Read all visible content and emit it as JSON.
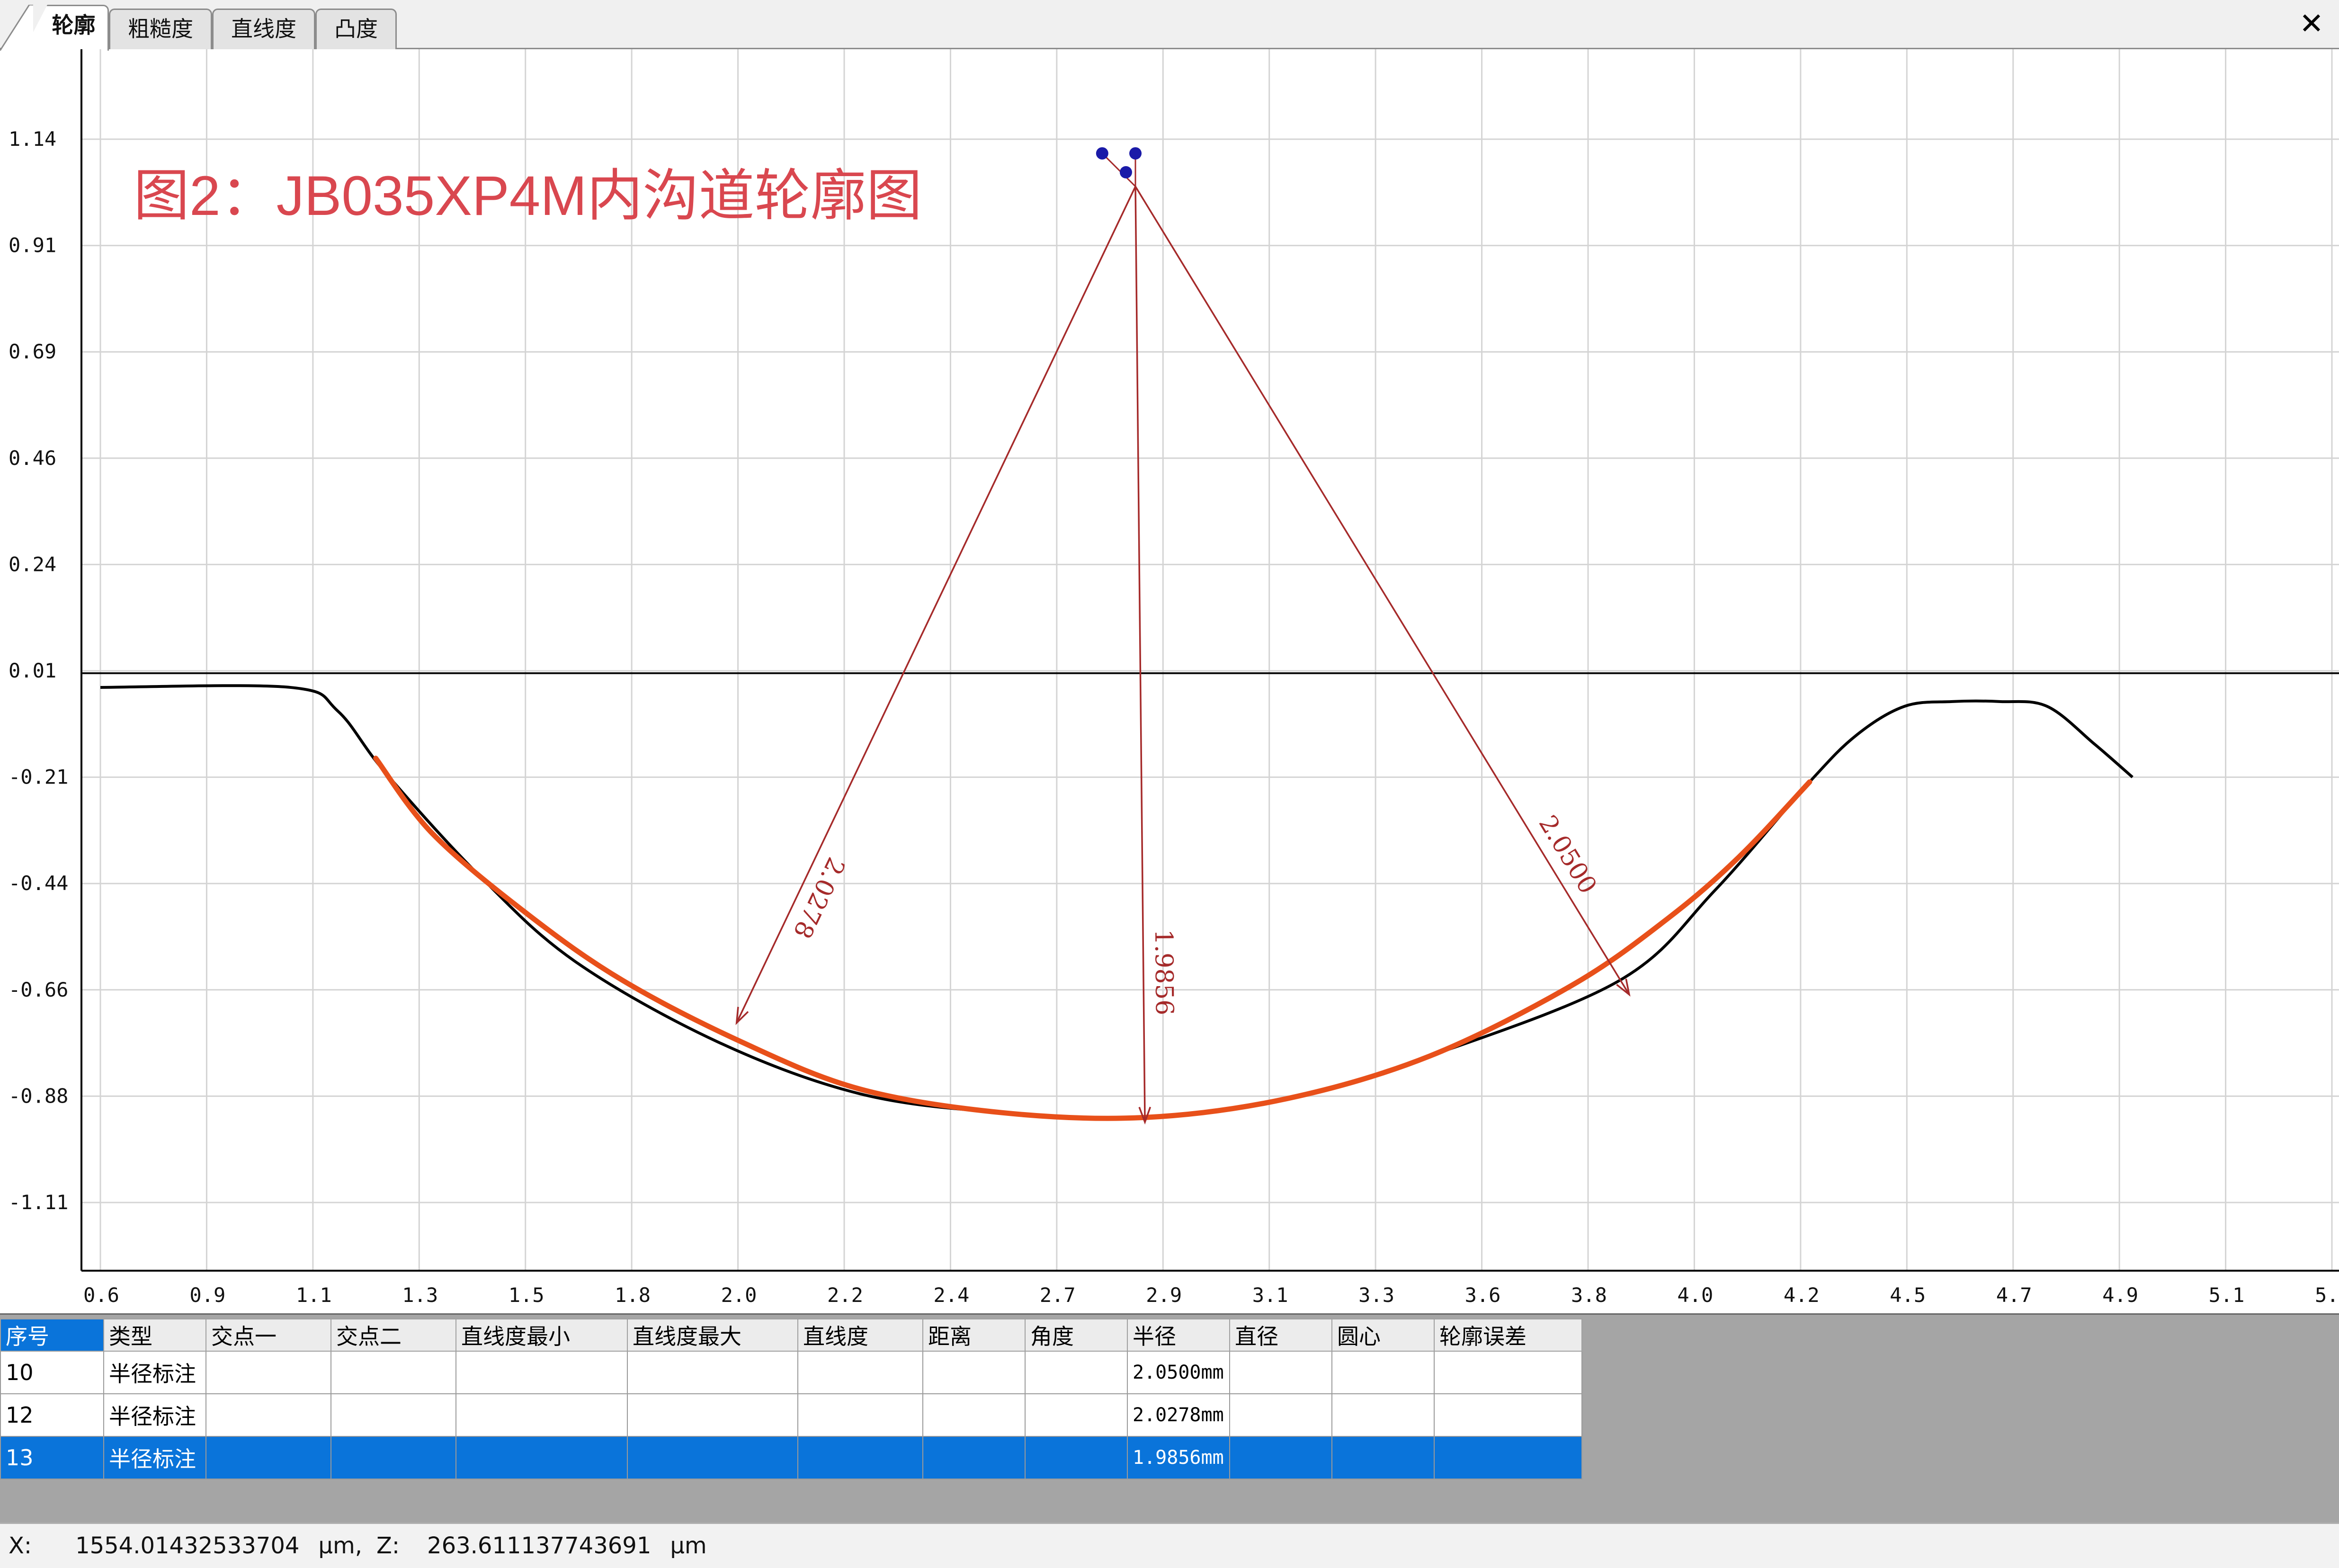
{
  "tabs": [
    {
      "label": "轮廓",
      "active": true
    },
    {
      "label": "粗糙度",
      "active": false
    },
    {
      "label": "直线度",
      "active": false
    },
    {
      "label": "凸度",
      "active": false
    }
  ],
  "window": {
    "close_glyph": "✕"
  },
  "figure_caption": "图2：JB035XP4M内沟道轮廓图",
  "chart_data": {
    "type": "line",
    "title": "",
    "xlabel": "",
    "ylabel": "",
    "y_ticks": [
      "1.14",
      "0.91",
      "0.69",
      "0.46",
      "0.24",
      "0.01",
      "-0.21",
      "-0.44",
      "-0.66",
      "-0.88",
      "-1.11"
    ],
    "x_ticks": [
      "0.6",
      "0.9",
      "1.1",
      "1.3",
      "1.5",
      "1.8",
      "2.0",
      "2.2",
      "2.4",
      "2.7",
      "2.9",
      "3.1",
      "3.3",
      "3.6",
      "3.8",
      "4.0",
      "4.2",
      "4.5",
      "4.7",
      "4.9",
      "5.1",
      "5."
    ],
    "grid": true,
    "reference_line_y": 0.01,
    "profile_x": [
      0.6,
      1.0,
      1.1,
      1.2,
      1.4,
      1.6,
      1.9,
      2.2,
      2.5,
      2.8,
      3.1,
      3.4,
      3.8,
      4.0,
      4.2,
      4.3,
      4.4,
      4.5,
      4.6,
      4.7,
      4.8,
      4.88
    ],
    "profile_y": [
      -0.02,
      -0.02,
      -0.07,
      -0.2,
      -0.42,
      -0.6,
      -0.77,
      -0.88,
      -0.92,
      -0.93,
      -0.89,
      -0.8,
      -0.64,
      -0.45,
      -0.22,
      -0.12,
      -0.06,
      -0.05,
      -0.05,
      -0.06,
      -0.14,
      -0.21
    ],
    "arc_fit_x": [
      1.18,
      1.3,
      1.5,
      1.7,
      1.95,
      2.2,
      2.5,
      2.8,
      3.1,
      3.4,
      3.7,
      3.9,
      4.05,
      4.2
    ],
    "arc_fit_y": [
      -0.17,
      -0.33,
      -0.5,
      -0.64,
      -0.77,
      -0.87,
      -0.92,
      -0.93,
      -0.89,
      -0.8,
      -0.65,
      -0.51,
      -0.38,
      -0.22
    ],
    "arc_color": "#e8501a",
    "profile_color": "#000000",
    "annotation_color": "#a52a2a",
    "center_point": [
      2.78,
      1.04
    ],
    "radius_annotations": [
      {
        "label": "2.0278",
        "to": [
          1.94,
          -0.73
        ]
      },
      {
        "label": "1.9856",
        "to": [
          2.8,
          -0.94
        ]
      },
      {
        "label": "2.0500",
        "to": [
          3.82,
          -0.67
        ]
      }
    ],
    "marker_points": [
      [
        2.71,
        1.11
      ],
      [
        2.78,
        1.11
      ],
      [
        2.76,
        1.07
      ]
    ],
    "marker_color": "#1a1aa8"
  },
  "table": {
    "columns": [
      "序号",
      "类型",
      "交点一",
      "交点二",
      "直线度最小",
      "直线度最大",
      "直线度",
      "距离",
      "角度",
      "半径",
      "直径",
      "圆心",
      "轮廓误差"
    ],
    "rows": [
      {
        "id": "10",
        "type": "半径标注",
        "radius": "2.0500mm",
        "selected": false
      },
      {
        "id": "12",
        "type": "半径标注",
        "radius": "2.0278mm",
        "selected": false
      },
      {
        "id": "13",
        "type": "半径标注",
        "radius": "1.9856mm",
        "selected": true
      }
    ]
  },
  "status": {
    "x_label": "X:",
    "x_value": "1554.01432533704",
    "x_unit": "μm,",
    "z_label": "Z:",
    "z_value": "263.611137743691",
    "z_unit": "μm"
  }
}
